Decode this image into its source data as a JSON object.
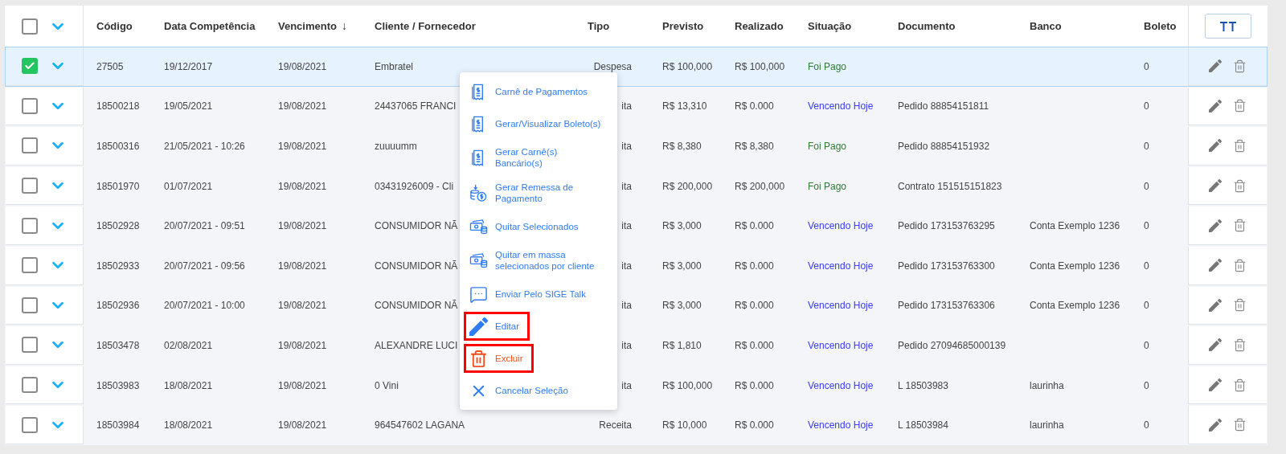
{
  "table": {
    "header_checkbox": {
      "checked": false
    },
    "columns": [
      {
        "label": "Código"
      },
      {
        "label": "Data Competência"
      },
      {
        "label": "Vencimento",
        "sort_mark": "↓"
      },
      {
        "label": "Cliente / Fornecedor"
      },
      {
        "label": "Tipo"
      },
      {
        "label": "Previsto"
      },
      {
        "label": "Realizado"
      },
      {
        "label": "Situação"
      },
      {
        "label": "Documento"
      },
      {
        "label": "Banco"
      },
      {
        "label": "Boleto"
      }
    ],
    "rows": [
      {
        "selected": true,
        "checked": true,
        "codigo": "27505",
        "competencia": "19/12/2017",
        "vencimento": "19/08/2021",
        "cliente": "Embratel",
        "tipo": "Despesa",
        "previsto": "R$ 100,000",
        "realizado": "R$ 100,000",
        "situacao": {
          "text": "Foi Pago",
          "color": "#2e7d32"
        },
        "boleto": "0"
      },
      {
        "selected": false,
        "checked": false,
        "codigo": "18500218",
        "competencia": "19/05/2021",
        "vencimento": "19/08/2021",
        "cliente": "24437065 FRANCI",
        "tipo": "ita",
        "previsto": "R$ 13,310",
        "realizado": "R$ 0.000",
        "situacao": {
          "text": "Vencendo Hoje",
          "color": "#3b3bf5"
        },
        "documento": "Pedido 88854151811",
        "boleto": "0"
      },
      {
        "selected": false,
        "checked": false,
        "codigo": "18500316",
        "competencia": "21/05/2021 - 10:26",
        "vencimento": "19/08/2021",
        "cliente": "zuuuumm",
        "tipo": "ita",
        "previsto": "R$ 8,380",
        "realizado": "R$ 8,380",
        "situacao": {
          "text": "Foi Pago",
          "color": "#2e7d32"
        },
        "documento": "Pedido 88854151932",
        "boleto": "0"
      },
      {
        "selected": false,
        "checked": false,
        "codigo": "18501970",
        "competencia": "01/07/2021",
        "vencimento": "19/08/2021",
        "cliente": "03431926009 - Cli",
        "tipo": "ita",
        "previsto": "R$ 200,000",
        "realizado": "R$ 200,000",
        "situacao": {
          "text": "Foi Pago",
          "color": "#2e7d32"
        },
        "documento": "Contrato 151515151823",
        "boleto": "0"
      },
      {
        "selected": false,
        "checked": false,
        "codigo": "18502928",
        "competencia": "20/07/2021 - 09:51",
        "vencimento": "19/08/2021",
        "cliente": "CONSUMIDOR NÃ",
        "tipo": "ita",
        "previsto": "R$ 3,000",
        "realizado": "R$ 0.000",
        "situacao": {
          "text": "Vencendo Hoje",
          "color": "#3b3bf5"
        },
        "documento": "Pedido 173153763295",
        "banco": "Conta Exemplo 1236",
        "boleto": "0"
      },
      {
        "selected": false,
        "checked": false,
        "codigo": "18502933",
        "competencia": "20/07/2021 - 09:56",
        "vencimento": "19/08/2021",
        "cliente": "CONSUMIDOR NÃ",
        "tipo": "ita",
        "previsto": "R$ 3,000",
        "realizado": "R$ 0.000",
        "situacao": {
          "text": "Vencendo Hoje",
          "color": "#3b3bf5"
        },
        "documento": "Pedido 173153763300",
        "banco": "Conta Exemplo 1236",
        "boleto": "0"
      },
      {
        "selected": false,
        "checked": false,
        "codigo": "18502936",
        "competencia": "20/07/2021 - 10:00",
        "vencimento": "19/08/2021",
        "cliente": "CONSUMIDOR NÃ",
        "tipo": "ita",
        "previsto": "R$ 3,000",
        "realizado": "R$ 0.000",
        "situacao": {
          "text": "Vencendo Hoje",
          "color": "#3b3bf5"
        },
        "documento": "Pedido 173153763306",
        "banco": "Conta Exemplo 1236",
        "boleto": "0"
      },
      {
        "selected": false,
        "checked": false,
        "codigo": "18503478",
        "competencia": "02/08/2021",
        "vencimento": "19/08/2021",
        "cliente": "ALEXANDRE LUCI",
        "tipo": "ita",
        "previsto": "R$ 1,810",
        "realizado": "R$ 0.000",
        "situacao": {
          "text": "Vencendo Hoje",
          "color": "#3b3bf5"
        },
        "documento": "Pedido 27094685000139",
        "boleto": "0"
      },
      {
        "selected": false,
        "checked": false,
        "codigo": "18503983",
        "competencia": "18/08/2021",
        "vencimento": "19/08/2021",
        "cliente": "0 Vini",
        "tipo": "ita",
        "previsto": "R$ 100,000",
        "realizado": "R$ 0.000",
        "situacao": {
          "text": "Vencendo Hoje",
          "color": "#3b3bf5"
        },
        "documento": "L 18503983",
        "banco": "laurinha",
        "boleto": "0"
      },
      {
        "selected": false,
        "checked": false,
        "codigo": "18503984",
        "competencia": "18/08/2021",
        "vencimento": "19/08/2021",
        "cliente": "964547602 LAGANA",
        "tipo": "Receita",
        "previsto": "R$ 10,000",
        "realizado": "R$ 0.000",
        "situacao": {
          "text": "Vencendo Hoje",
          "color": "#3b3bf5"
        },
        "documento": "L 18503984",
        "banco": "laurinha",
        "boleto": "0"
      }
    ]
  },
  "context_menu": {
    "items": [
      {
        "kind": "receipt",
        "label": "Carnê de Pagamentos",
        "highlighted": false
      },
      {
        "kind": "receipt",
        "label": "Gerar/Visualizar Boleto(s)",
        "highlighted": false
      },
      {
        "kind": "receipt",
        "label": "Gerar Carnê(s) Bancário(s)",
        "highlighted": false
      },
      {
        "kind": "remittance",
        "label": "Gerar Remessa de Pagamento",
        "highlighted": false
      },
      {
        "kind": "cash",
        "label": "Quitar Selecionados",
        "highlighted": false
      },
      {
        "kind": "cash",
        "label": "Quitar em massa selecionados por cliente",
        "highlighted": false
      },
      {
        "kind": "chat",
        "label": "Enviar Pelo SIGE Talk",
        "highlighted": false
      },
      {
        "kind": "edit",
        "label": "Editar",
        "highlighted": true
      },
      {
        "kind": "delete",
        "label": "Excluir",
        "highlighted": true
      },
      {
        "kind": "cancel",
        "label": "Cancelar Seleção",
        "highlighted": false
      }
    ]
  }
}
